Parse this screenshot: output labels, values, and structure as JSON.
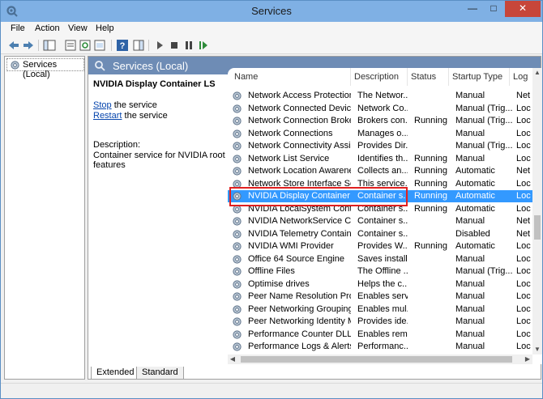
{
  "window": {
    "title": "Services"
  },
  "menu": {
    "items": [
      "File",
      "Action",
      "View",
      "Help"
    ]
  },
  "tree": {
    "root_label": "Services (Local)"
  },
  "panel": {
    "header_title": "Services (Local)",
    "selected_title": "NVIDIA Display Container LS",
    "stop_link": "Stop",
    "stop_suffix": " the service",
    "restart_link": "Restart",
    "restart_suffix": " the service",
    "description_label": "Description:",
    "description_lines": [
      "Container service for NVIDIA root",
      "features"
    ]
  },
  "list": {
    "columns": [
      "Name",
      "Description",
      "Status",
      "Startup Type",
      "Log"
    ],
    "rows": [
      {
        "name": "Network Access Protection ...",
        "description": "The Networ...",
        "status": "",
        "startup": "Manual",
        "logon": "Net"
      },
      {
        "name": "Network Connected Device...",
        "description": "Network Co...",
        "status": "",
        "startup": "Manual (Trig...",
        "logon": "Loc"
      },
      {
        "name": "Network Connection Broker",
        "description": "Brokers con...",
        "status": "Running",
        "startup": "Manual (Trig...",
        "logon": "Loc"
      },
      {
        "name": "Network Connections",
        "description": "Manages o...",
        "status": "",
        "startup": "Manual",
        "logon": "Loc"
      },
      {
        "name": "Network Connectivity Assis...",
        "description": "Provides Dir...",
        "status": "",
        "startup": "Manual (Trig...",
        "logon": "Loc"
      },
      {
        "name": "Network List Service",
        "description": "Identifies th...",
        "status": "Running",
        "startup": "Manual",
        "logon": "Loc"
      },
      {
        "name": "Network Location Awareness",
        "description": "Collects an...",
        "status": "Running",
        "startup": "Automatic",
        "logon": "Net"
      },
      {
        "name": "Network Store Interface Ser...",
        "description": "This service...",
        "status": "Running",
        "startup": "Automatic",
        "logon": "Loc"
      },
      {
        "name": "NVIDIA Display Container LS",
        "description": "Container s...",
        "status": "Running",
        "startup": "Automatic",
        "logon": "Loc"
      },
      {
        "name": "NVIDIA LocalSystem Contai...",
        "description": "Container s...",
        "status": "Running",
        "startup": "Automatic",
        "logon": "Loc"
      },
      {
        "name": "NVIDIA NetworkService Co...",
        "description": "Container s...",
        "status": "",
        "startup": "Manual",
        "logon": "Net"
      },
      {
        "name": "NVIDIA Telemetry Container",
        "description": "Container s...",
        "status": "",
        "startup": "Disabled",
        "logon": "Net"
      },
      {
        "name": "NVIDIA WMI Provider",
        "description": "Provides W...",
        "status": "Running",
        "startup": "Automatic",
        "logon": "Loc"
      },
      {
        "name": "Office 64 Source Engine",
        "description": "Saves install...",
        "status": "",
        "startup": "Manual",
        "logon": "Loc"
      },
      {
        "name": "Offline Files",
        "description": "The Offline ...",
        "status": "",
        "startup": "Manual (Trig...",
        "logon": "Loc"
      },
      {
        "name": "Optimise drives",
        "description": "Helps the c...",
        "status": "",
        "startup": "Manual",
        "logon": "Loc"
      },
      {
        "name": "Peer Name Resolution Prot...",
        "description": "Enables serv...",
        "status": "",
        "startup": "Manual",
        "logon": "Loc"
      },
      {
        "name": "Peer Networking Grouping",
        "description": "Enables mul...",
        "status": "",
        "startup": "Manual",
        "logon": "Loc"
      },
      {
        "name": "Peer Networking Identity M...",
        "description": "Provides ide...",
        "status": "",
        "startup": "Manual",
        "logon": "Loc"
      },
      {
        "name": "Performance Counter DLL ...",
        "description": "Enables rem...",
        "status": "",
        "startup": "Manual",
        "logon": "Loc"
      },
      {
        "name": "Performance Logs & Alerts",
        "description": "Performanc...",
        "status": "",
        "startup": "Manual",
        "logon": "Loc"
      }
    ],
    "selected_index": 8
  },
  "tabs": [
    "Extended",
    "Standard"
  ],
  "colors": {
    "selection": "#3399ff",
    "highlight_box": "#e02020",
    "link": "#0645ad"
  }
}
